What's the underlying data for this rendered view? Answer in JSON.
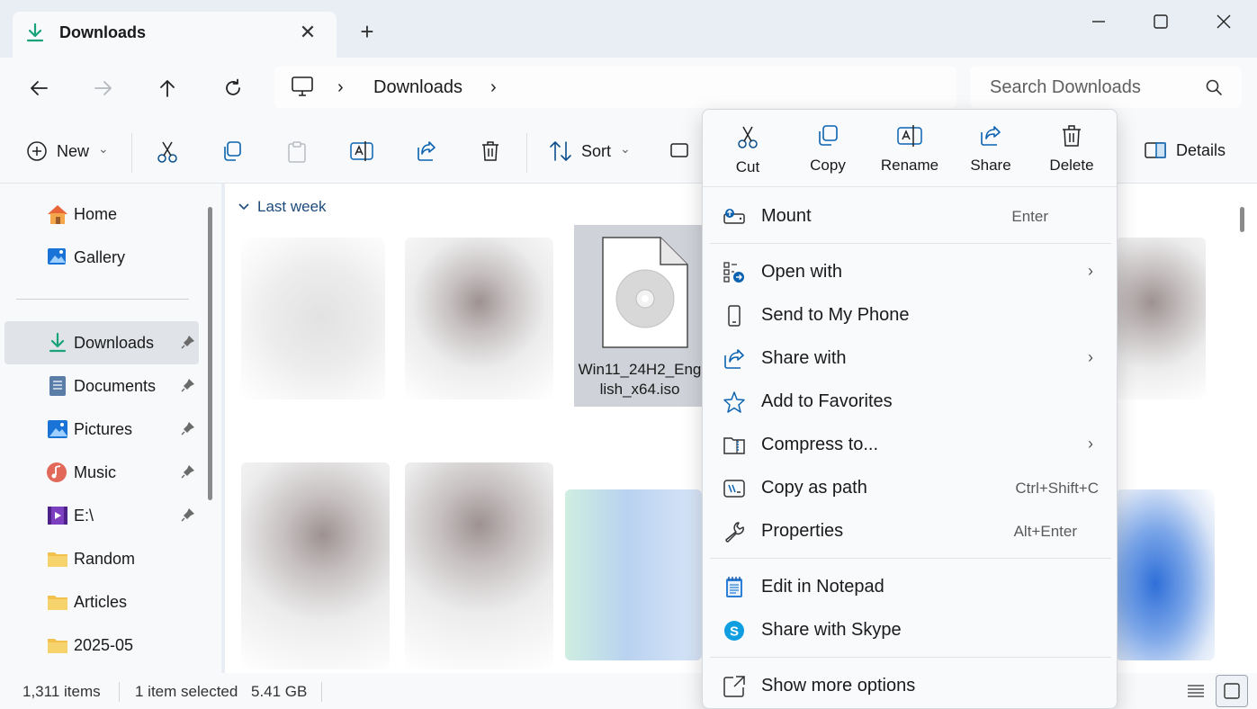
{
  "tab": {
    "title": "Downloads",
    "close": "✕",
    "new": "+"
  },
  "address": {
    "location": "Downloads",
    "sep1": "›",
    "sep2": "›"
  },
  "search": {
    "placeholder": "Search Downloads"
  },
  "toolbar": {
    "new_label": "New",
    "sort_label": "Sort",
    "details_label": "Details",
    "dropdown": "⌄"
  },
  "sidebar": {
    "items": [
      {
        "label": "Home"
      },
      {
        "label": "Gallery"
      },
      {
        "label": "Downloads"
      },
      {
        "label": "Documents"
      },
      {
        "label": "Pictures"
      },
      {
        "label": "Music"
      },
      {
        "label": "E:\\"
      },
      {
        "label": "Random"
      },
      {
        "label": "Articles"
      },
      {
        "label": "2025-05"
      }
    ]
  },
  "content": {
    "group_header": "Last week",
    "selected_file": {
      "name_line1": "Win11_24H2_Eng",
      "name_line2": "lish_x64.iso"
    }
  },
  "status": {
    "item_count": "1,311 items",
    "selected": "1 item selected",
    "size": "5.41 GB"
  },
  "context_menu": {
    "actions": [
      {
        "label": "Cut"
      },
      {
        "label": "Copy"
      },
      {
        "label": "Rename"
      },
      {
        "label": "Share"
      },
      {
        "label": "Delete"
      }
    ],
    "items": [
      {
        "label": "Mount",
        "shortcut": "Enter"
      },
      {
        "label": "Open with",
        "submenu": "›"
      },
      {
        "label": "Send to My Phone"
      },
      {
        "label": "Share with",
        "submenu": "›"
      },
      {
        "label": "Add to Favorites"
      },
      {
        "label": "Compress to...",
        "submenu": "›"
      },
      {
        "label": "Copy as path",
        "shortcut": "Ctrl+Shift+C"
      },
      {
        "label": "Properties",
        "shortcut": "Alt+Enter"
      },
      {
        "label": "Edit in Notepad"
      },
      {
        "label": "Share with Skype"
      },
      {
        "label": "Show more options"
      }
    ]
  },
  "colors": {
    "accent": "#0067c0",
    "downloads_green": "#1aa37a",
    "folder_yellow": "#f2c14e",
    "selection": "#cfd3d9"
  }
}
